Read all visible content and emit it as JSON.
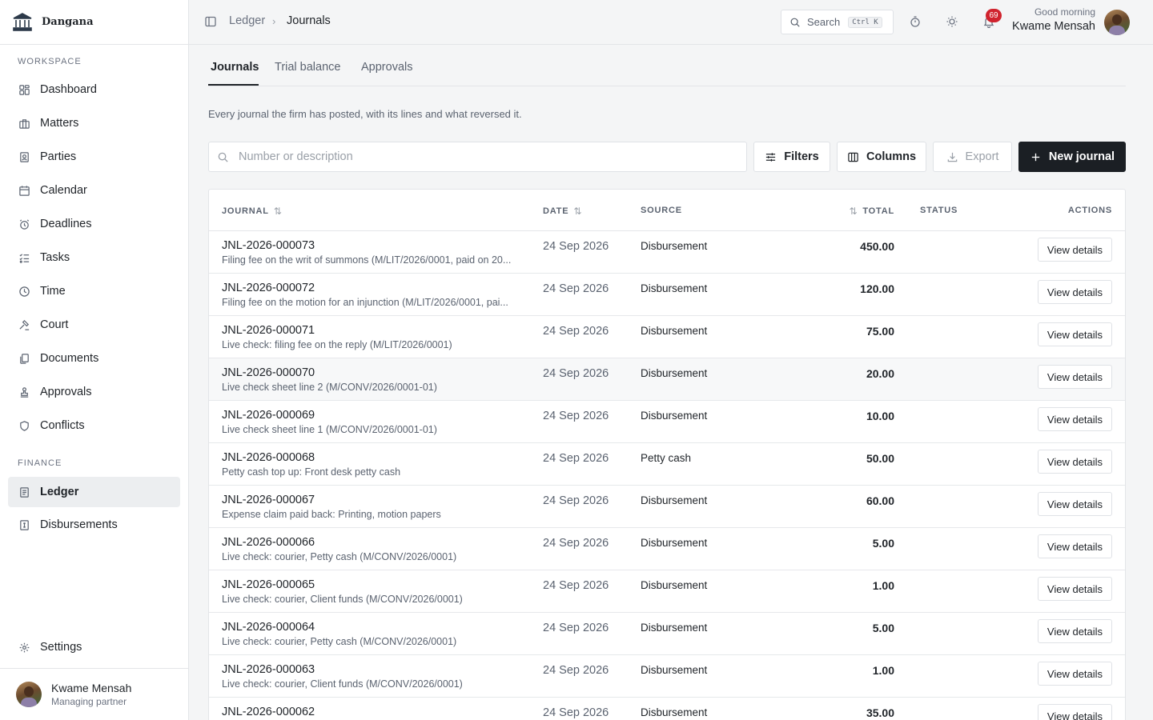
{
  "app": {
    "brand": "Dangana"
  },
  "sidebar": {
    "workspace_label": "WORKSPACE",
    "finance_label": "FINANCE",
    "workspace_items": [
      {
        "label": "Dashboard",
        "icon": "dashboard-icon"
      },
      {
        "label": "Matters",
        "icon": "briefcase-icon"
      },
      {
        "label": "Parties",
        "icon": "contact-icon"
      },
      {
        "label": "Calendar",
        "icon": "calendar-icon"
      },
      {
        "label": "Deadlines",
        "icon": "alarm-icon"
      },
      {
        "label": "Tasks",
        "icon": "checklist-icon"
      },
      {
        "label": "Time",
        "icon": "clock-icon"
      },
      {
        "label": "Court",
        "icon": "gavel-icon"
      },
      {
        "label": "Documents",
        "icon": "documents-icon"
      },
      {
        "label": "Approvals",
        "icon": "stamp-icon"
      },
      {
        "label": "Conflicts",
        "icon": "shield-icon"
      }
    ],
    "finance_items": [
      {
        "label": "Ledger",
        "icon": "ledger-icon",
        "active": true
      },
      {
        "label": "Disbursements",
        "icon": "receipt-icon"
      }
    ],
    "settings_label": "Settings",
    "user": {
      "name": "Kwame Mensah",
      "role": "Managing partner"
    }
  },
  "topbar": {
    "breadcrumb": {
      "parent": "Ledger",
      "current": "Journals"
    },
    "search": {
      "label": "Search",
      "shortcut": "Ctrl K"
    },
    "notifications_count": "69",
    "greeting": "Good morning",
    "user_name": "Kwame Mensah"
  },
  "tabs": [
    "Journals",
    "Trial balance",
    "Approvals"
  ],
  "active_tab": "Journals",
  "page": {
    "description": "Every journal the firm has posted, with its lines and what reversed it.",
    "search_placeholder": "Number or description",
    "filters_label": "Filters",
    "columns_label": "Columns",
    "export_label": "Export",
    "new_label": "New journal"
  },
  "table": {
    "headers": {
      "journal": "JOURNAL",
      "date": "DATE",
      "source": "SOURCE",
      "total": "TOTAL",
      "status": "STATUS",
      "actions": "ACTIONS"
    },
    "action_label": "View details",
    "rows": [
      {
        "number": "JNL-2026-000073",
        "description": "Filing fee on the writ of summons (M/LIT/2026/0001, paid on 20...",
        "date": "24 Sep 2026",
        "source": "Disbursement",
        "total": "450.00",
        "status": ""
      },
      {
        "number": "JNL-2026-000072",
        "description": "Filing fee on the motion for an injunction (M/LIT/2026/0001, pai...",
        "date": "24 Sep 2026",
        "source": "Disbursement",
        "total": "120.00",
        "status": ""
      },
      {
        "number": "JNL-2026-000071",
        "description": "Live check: filing fee on the reply (M/LIT/2026/0001)",
        "date": "24 Sep 2026",
        "source": "Disbursement",
        "total": "75.00",
        "status": ""
      },
      {
        "number": "JNL-2026-000070",
        "description": "Live check sheet line 2 (M/CONV/2026/0001-01)",
        "date": "24 Sep 2026",
        "source": "Disbursement",
        "total": "20.00",
        "status": ""
      },
      {
        "number": "JNL-2026-000069",
        "description": "Live check sheet line 1 (M/CONV/2026/0001-01)",
        "date": "24 Sep 2026",
        "source": "Disbursement",
        "total": "10.00",
        "status": ""
      },
      {
        "number": "JNL-2026-000068",
        "description": "Petty cash top up: Front desk petty cash",
        "date": "24 Sep 2026",
        "source": "Petty cash",
        "total": "50.00",
        "status": ""
      },
      {
        "number": "JNL-2026-000067",
        "description": "Expense claim paid back: Printing, motion papers",
        "date": "24 Sep 2026",
        "source": "Disbursement",
        "total": "60.00",
        "status": ""
      },
      {
        "number": "JNL-2026-000066",
        "description": "Live check: courier, Petty cash (M/CONV/2026/0001)",
        "date": "24 Sep 2026",
        "source": "Disbursement",
        "total": "5.00",
        "status": ""
      },
      {
        "number": "JNL-2026-000065",
        "description": "Live check: courier, Client funds (M/CONV/2026/0001)",
        "date": "24 Sep 2026",
        "source": "Disbursement",
        "total": "1.00",
        "status": ""
      },
      {
        "number": "JNL-2026-000064",
        "description": "Live check: courier, Petty cash (M/CONV/2026/0001)",
        "date": "24 Sep 2026",
        "source": "Disbursement",
        "total": "5.00",
        "status": ""
      },
      {
        "number": "JNL-2026-000063",
        "description": "Live check: courier, Client funds (M/CONV/2026/0001)",
        "date": "24 Sep 2026",
        "source": "Disbursement",
        "total": "1.00",
        "status": ""
      },
      {
        "number": "JNL-2026-000062",
        "description": "",
        "date": "24 Sep 2026",
        "source": "Disbursement",
        "total": "35.00",
        "status": ""
      }
    ]
  },
  "colors": {
    "primary_button": "#1b1f24",
    "badge": "#d0232e",
    "active_nav": "#eceef0"
  }
}
